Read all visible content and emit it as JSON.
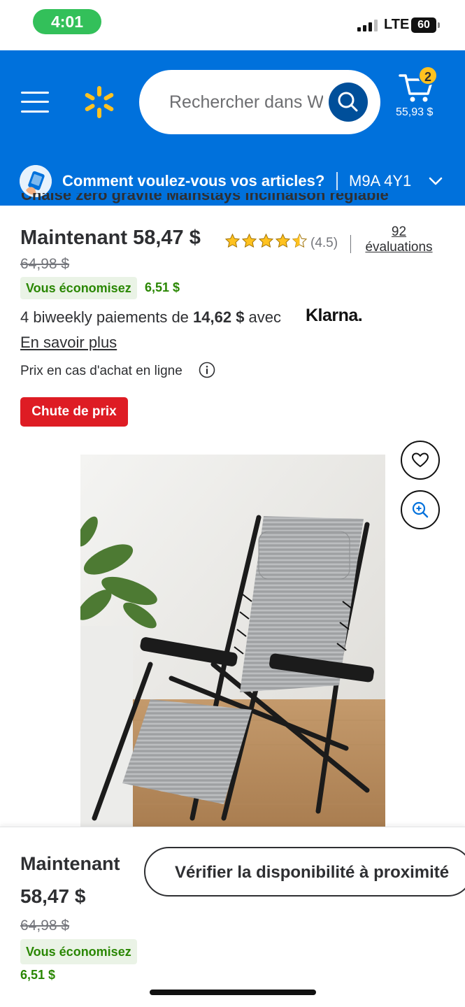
{
  "status_bar": {
    "time": "4:01",
    "network": "LTE",
    "battery": "60"
  },
  "header": {
    "search_placeholder": "Rechercher dans Walmart",
    "cart_count": "2",
    "cart_total": "55,93 $",
    "fulfillment_prompt": "Comment voulez-vous vos articles?",
    "postal_code": "M9A 4Y1",
    "brand_color": "#0071dc",
    "accent_color": "#ffc220"
  },
  "product": {
    "title": "Chaise zéro gravité Mainstays inclinaison réglable",
    "price_label": "Maintenant 58,47 $",
    "rating_value": 4.5,
    "rating_text": "(4.5)",
    "review_count": "92",
    "reviews_label": "évaluations",
    "old_price": "64,98 $",
    "savings_label": "Vous économisez",
    "savings_amount": "6,51 $",
    "klarna_prefix": "4 biweekly paiements de ",
    "klarna_amount": "14,62 $",
    "klarna_suffix": " avec ",
    "klarna_brand": "Klarna.",
    "learn_more": "En savoir plus",
    "online_price_note": "Prix en cas d'achat en ligne",
    "badge": "Chute de prix",
    "image_alt": "Chaise zéro gravité grise avec appui-tête"
  },
  "sticky_bar": {
    "label": "Maintenant",
    "price": "58,47 $",
    "old_price": "64,98 $",
    "savings_label": "Vous économisez",
    "savings_amount": "6,51 $",
    "cta": "Vérifier la disponibilité à proximité"
  },
  "icons": [
    "menu-icon",
    "walmart-spark-icon",
    "search-icon",
    "cart-icon",
    "location-icon",
    "chevron-down-icon",
    "star-icon",
    "info-icon",
    "heart-icon",
    "zoom-in-icon"
  ]
}
